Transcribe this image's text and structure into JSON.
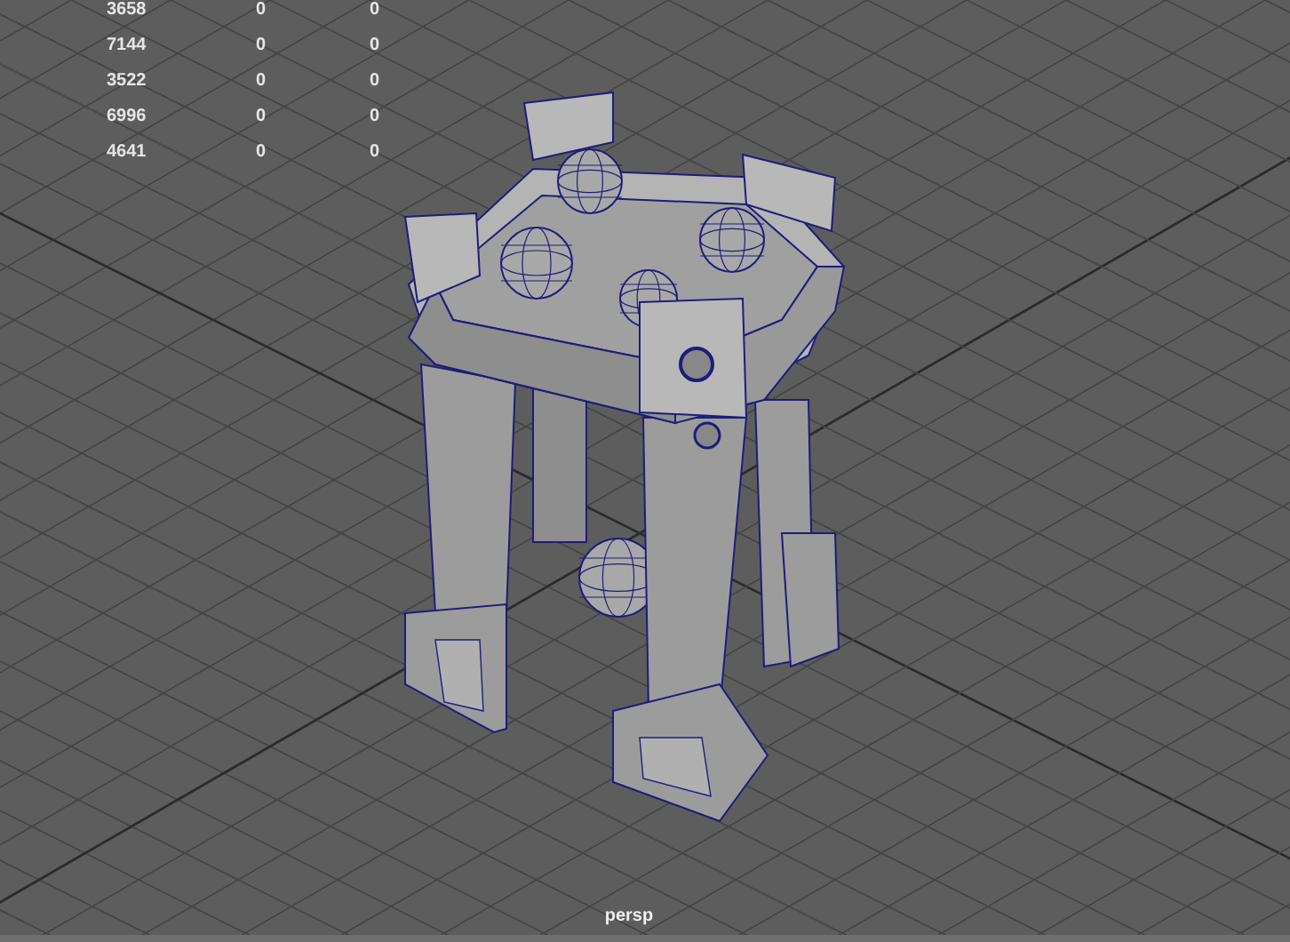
{
  "hud": {
    "rows": [
      {
        "cells": [
          "3658",
          "0",
          "0"
        ]
      },
      {
        "cells": [
          "7144",
          "0",
          "0"
        ]
      },
      {
        "cells": [
          "3522",
          "0",
          "0"
        ]
      },
      {
        "cells": [
          "6996",
          "0",
          "0"
        ]
      },
      {
        "cells": [
          "4641",
          "0",
          "0"
        ]
      }
    ]
  },
  "viewport": {
    "camera_label": "persp"
  }
}
